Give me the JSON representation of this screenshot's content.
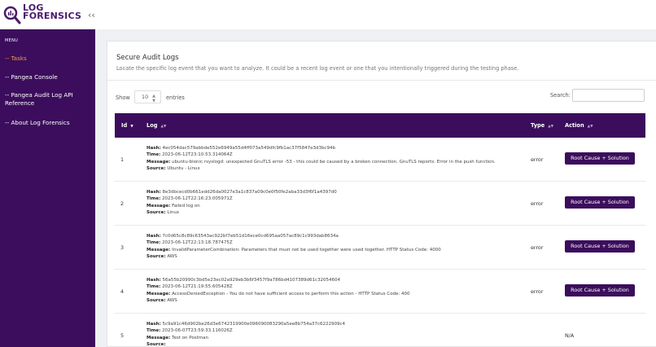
{
  "app": {
    "logo_line1": "LOG",
    "logo_line2": "FORENSICS",
    "brand_color": "#3b0d5c",
    "accent_color": "#f0a03c"
  },
  "sidebar": {
    "menu_title": "MENU",
    "items": [
      {
        "label": "-- Tasks",
        "active": true
      },
      {
        "label": "-- Pangea Console",
        "active": false
      },
      {
        "label": "-- Pangea Audit Log API Reference",
        "active": false
      },
      {
        "label": "-- About Log Forensics",
        "active": false
      }
    ]
  },
  "main": {
    "title": "Secure Audit Logs",
    "subtitle": "Locate the specific log event that you want to analyze. It could be a recent log event or one that you intentionally triggered during the testing phase.",
    "show_label": "Show",
    "page_size": "10",
    "entries_label": "entries",
    "search_label": "Search:",
    "search_value": ""
  },
  "table": {
    "columns": [
      "Id",
      "Log",
      "Type",
      "Action"
    ],
    "action_label": "Root Cause + Solution",
    "field_labels": {
      "hash": "Hash:",
      "time": "Time:",
      "message": "Message:",
      "source": "Source:"
    },
    "rows": [
      {
        "id": "1",
        "hash": "4ec054dac579abbde552e6949a55d4ff073a549dfc9fb1ac37f5847e3d3bc94b",
        "time": "2023-06-12T23:10:53.314064Z",
        "message": "ubuntu-bionic rsyslogd: unexpected GnuTLS error -53 - this could be caused by a broken connection. GnuTLS reports: Error in the push function.",
        "source": "Ubuntu - Linux",
        "type": "error",
        "action": "Root Cause + Solution"
      },
      {
        "id": "2",
        "hash": "8e3dbcecd0b661edd26da0027e3a1c837a09c0e0f50fe2aba33d3f6f1a4397d0",
        "time": "2023-06-12T22:16:23.005971Z",
        "message": "Failed log on",
        "source": "Linux",
        "type": "error",
        "action": "Root Cause + Solution"
      },
      {
        "id": "3",
        "hash": "7c0d65c8c89c63543ac922bf7eb51d16ece0cd695aa057ac89c1c993dab8634a",
        "time": "2023-06-12T22:13:18.787475Z",
        "message": "InvalidParameterCombination: Parameters that must not be used together were used together. HTTP Status Code: 4000",
        "source": "AWS",
        "type": "error",
        "action": "Root Cause + Solution"
      },
      {
        "id": "4",
        "hash": "56a55b20990c3bd5e23ec02a929eb3b6f3457f9a786bd4107389d61c32054604",
        "time": "2023-06-12T21:19:55.605428Z",
        "message": "AccessDeniedException - You do not have sufficient access to perform this action - HTTP Status Code: 400",
        "source": "AWS",
        "type": "error",
        "action": "Root Cause + Solution"
      },
      {
        "id": "5",
        "hash": "5c9a91c46d902be26d3e6742319900e096090083290a5ee8b754a37c6222909c4",
        "time": "2023-06-07T23:59:33.116026Z",
        "message": "Test on Postman",
        "source": "",
        "type": "",
        "action": "N/A"
      }
    ]
  }
}
